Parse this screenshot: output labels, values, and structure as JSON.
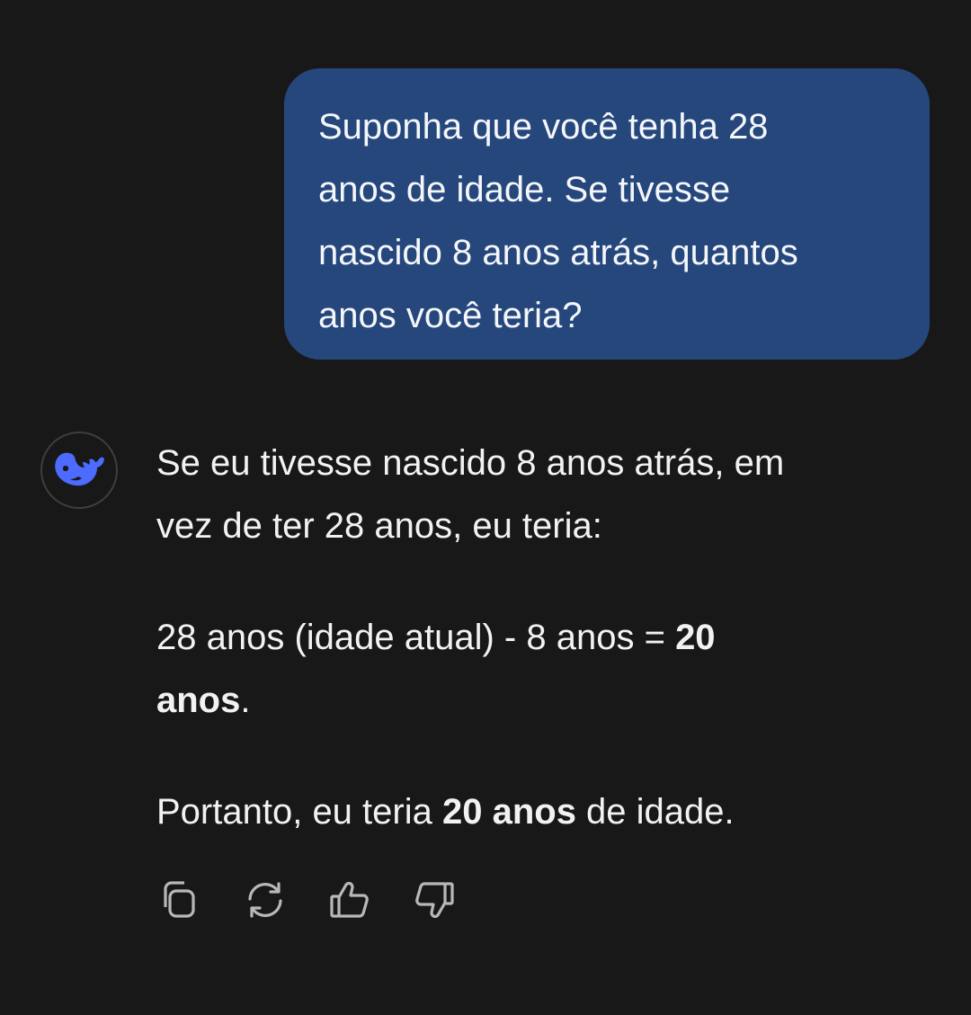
{
  "user_message": {
    "lines": [
      "Suponha que você tenha 28",
      "anos de idade. Se tivesse",
      "nascido 8 anos atrás, quantos",
      "anos você teria?"
    ]
  },
  "assistant": {
    "avatar_icon": "whale-logo-icon",
    "para1": {
      "lines": [
        "Se eu tivesse nascido 8 anos atrás, em",
        "vez de ter 28 anos, eu teria:"
      ]
    },
    "para2": {
      "line1_prefix": "28 anos (idade atual) - 8 anos = ",
      "line1_bold": "20",
      "line2_bold": "anos",
      "line2_suffix": "."
    },
    "para3": {
      "prefix": "Portanto, eu teria ",
      "bold": "20 anos",
      "suffix": " de idade."
    }
  },
  "actions": [
    {
      "icon": "copy-icon"
    },
    {
      "icon": "regenerate-icon"
    },
    {
      "icon": "thumbs-up-icon"
    },
    {
      "icon": "thumbs-down-icon"
    }
  ],
  "colors": {
    "background": "#181818",
    "user_bubble": "#26477c",
    "logo": "#4d6bfe",
    "icon": "#b8b8b8"
  }
}
